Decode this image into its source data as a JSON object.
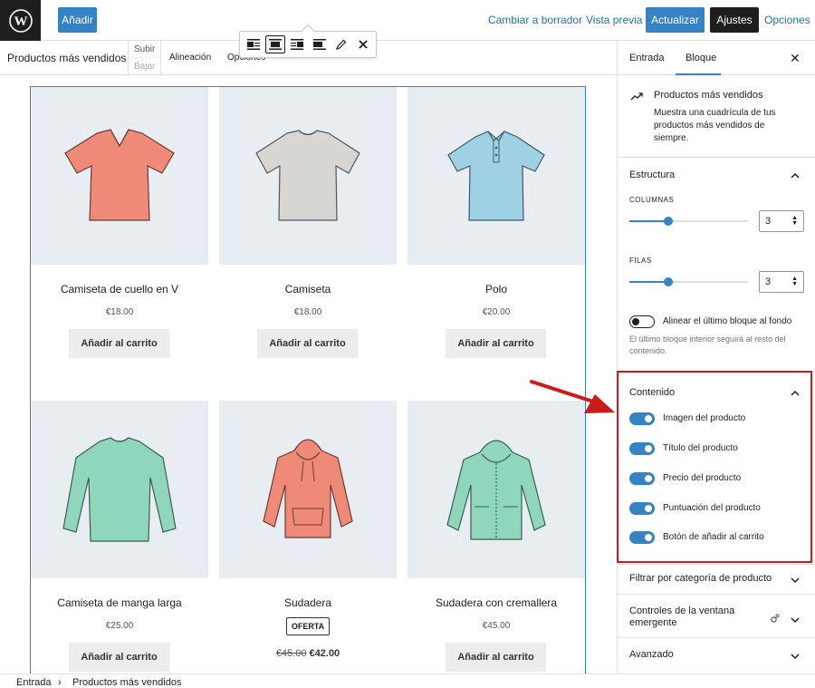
{
  "topbar": {
    "add_label": "Añadir",
    "draft_label": "Cambiar a borrador",
    "preview_label": "Vista previa",
    "update_label": "Actualizar",
    "settings_label": "Ajustes",
    "options_label": "Opciones"
  },
  "blockbar": {
    "block_name": "Productos más vendidos",
    "move_up": "Subir",
    "move_down": "Bajar",
    "align_label": "Alineación",
    "options_label": "Opciones"
  },
  "products": [
    {
      "title": "Camiseta de cuello en V",
      "price": "€18.00",
      "cart": "Añadir al carrito"
    },
    {
      "title": "Camiseta",
      "price": "€18.00",
      "cart": "Añadir al carrito"
    },
    {
      "title": "Polo",
      "price": "€20.00",
      "cart": "Añadir al carrito"
    },
    {
      "title": "Camiseta de manga larga",
      "price": "€25.00",
      "cart": "Añadir al carrito"
    },
    {
      "title": "Sudadera",
      "badge": "OFERTA",
      "old_price": "€45.00",
      "new_price": "€42.00"
    },
    {
      "title": "Sudadera con cremallera",
      "price": "€45.00",
      "cart": "Añadir al carrito"
    }
  ],
  "footer": {
    "crumb_1": "Entrada",
    "separator": "›",
    "crumb_2": "Productos más vendidos"
  },
  "sidebar": {
    "tab_post": "Entrada",
    "tab_block": "Bloque",
    "card_title": "Productos más vendidos",
    "card_desc": "Muestra una cuadrícula de tus productos más vendidos de siempre.",
    "structure_title": "Estructura",
    "columns_label": "COLUMNAS",
    "columns_value": "3",
    "columns_fraction": 0.33,
    "rows_label": "FILAS",
    "rows_value": "3",
    "rows_fraction": 0.33,
    "align_bottom_label": "Alinear el último bloque al fondo",
    "align_bottom_help": "El último bloque interior seguirá al resto del contenido.",
    "content_title": "Contenido",
    "content_toggles": [
      "Imagen del producto",
      "Título del producto",
      "Precio del producto",
      "Puntuación del producto",
      "Botón de añadir al carrito"
    ],
    "filter_title": "Filtrar por categoría de producto",
    "popup_title": "Controles de la ventana emergente",
    "advanced_title": "Avanzado"
  },
  "colors": {
    "accent": "#3582c4",
    "dark": "#1e1e1e",
    "highlight": "#cc1b1b",
    "coral": "#f08a78",
    "grey_shirt": "#d8d6d2",
    "blue_polo": "#9fd0e4",
    "mint": "#8fd6bd"
  }
}
